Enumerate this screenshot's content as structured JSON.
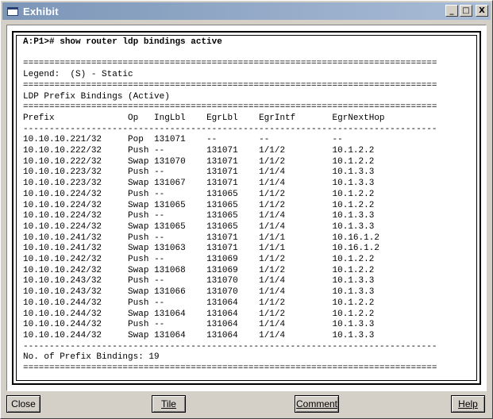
{
  "window": {
    "title": "Exhibit",
    "minimize": "_",
    "maximize": "□",
    "close": "X"
  },
  "terminal": {
    "prompt": "A:P1>#",
    "command": "show router ldp bindings active",
    "rule_double": "===============================================================================",
    "rule_single": "-------------------------------------------------------------------------------",
    "legend": "Legend:  (S) - Static",
    "section_title": "LDP Prefix Bindings (Active)",
    "columns": {
      "prefix": "Prefix",
      "op": "Op",
      "ing": "IngLbl",
      "egr": "EgrLbl",
      "intf": "EgrIntf",
      "nexthop": "EgrNextHop"
    },
    "rows": [
      {
        "prefix": "10.10.10.221/32",
        "op": "Pop",
        "ing": "131071",
        "egr": "--",
        "intf": "--",
        "nexthop": "--"
      },
      {
        "prefix": "10.10.10.222/32",
        "op": "Push",
        "ing": "--",
        "egr": "131071",
        "intf": "1/1/2",
        "nexthop": "10.1.2.2"
      },
      {
        "prefix": "10.10.10.222/32",
        "op": "Swap",
        "ing": "131070",
        "egr": "131071",
        "intf": "1/1/2",
        "nexthop": "10.1.2.2"
      },
      {
        "prefix": "10.10.10.223/32",
        "op": "Push",
        "ing": "--",
        "egr": "131071",
        "intf": "1/1/4",
        "nexthop": "10.1.3.3"
      },
      {
        "prefix": "10.10.10.223/32",
        "op": "Swap",
        "ing": "131067",
        "egr": "131071",
        "intf": "1/1/4",
        "nexthop": "10.1.3.3"
      },
      {
        "prefix": "10.10.10.224/32",
        "op": "Push",
        "ing": "--",
        "egr": "131065",
        "intf": "1/1/2",
        "nexthop": "10.1.2.2"
      },
      {
        "prefix": "10.10.10.224/32",
        "op": "Swap",
        "ing": "131065",
        "egr": "131065",
        "intf": "1/1/2",
        "nexthop": "10.1.2.2"
      },
      {
        "prefix": "10.10.10.224/32",
        "op": "Push",
        "ing": "--",
        "egr": "131065",
        "intf": "1/1/4",
        "nexthop": "10.1.3.3"
      },
      {
        "prefix": "10.10.10.224/32",
        "op": "Swap",
        "ing": "131065",
        "egr": "131065",
        "intf": "1/1/4",
        "nexthop": "10.1.3.3"
      },
      {
        "prefix": "10.10.10.241/32",
        "op": "Push",
        "ing": "--",
        "egr": "131071",
        "intf": "1/1/1",
        "nexthop": "10.16.1.2"
      },
      {
        "prefix": "10.10.10.241/32",
        "op": "Swap",
        "ing": "131063",
        "egr": "131071",
        "intf": "1/1/1",
        "nexthop": "10.16.1.2"
      },
      {
        "prefix": "10.10.10.242/32",
        "op": "Push",
        "ing": "--",
        "egr": "131069",
        "intf": "1/1/2",
        "nexthop": "10.1.2.2"
      },
      {
        "prefix": "10.10.10.242/32",
        "op": "Swap",
        "ing": "131068",
        "egr": "131069",
        "intf": "1/1/2",
        "nexthop": "10.1.2.2"
      },
      {
        "prefix": "10.10.10.243/32",
        "op": "Push",
        "ing": "--",
        "egr": "131070",
        "intf": "1/1/4",
        "nexthop": "10.1.3.3"
      },
      {
        "prefix": "10.10.10.243/32",
        "op": "Swap",
        "ing": "131066",
        "egr": "131070",
        "intf": "1/1/4",
        "nexthop": "10.1.3.3"
      },
      {
        "prefix": "10.10.10.244/32",
        "op": "Push",
        "ing": "--",
        "egr": "131064",
        "intf": "1/1/2",
        "nexthop": "10.1.2.2"
      },
      {
        "prefix": "10.10.10.244/32",
        "op": "Swap",
        "ing": "131064",
        "egr": "131064",
        "intf": "1/1/2",
        "nexthop": "10.1.2.2"
      },
      {
        "prefix": "10.10.10.244/32",
        "op": "Push",
        "ing": "--",
        "egr": "131064",
        "intf": "1/1/4",
        "nexthop": "10.1.3.3"
      },
      {
        "prefix": "10.10.10.244/32",
        "op": "Swap",
        "ing": "131064",
        "egr": "131064",
        "intf": "1/1/4",
        "nexthop": "10.1.3.3"
      }
    ],
    "footer": "No. of Prefix Bindings: 19"
  },
  "buttons": {
    "close": "Close",
    "tile": "Tile",
    "comment": "Comment",
    "help": "Help"
  },
  "colors": {
    "titlebar_start": "#7c96b8",
    "titlebar_end": "#a9bcd6",
    "face": "#d4d0c8"
  }
}
